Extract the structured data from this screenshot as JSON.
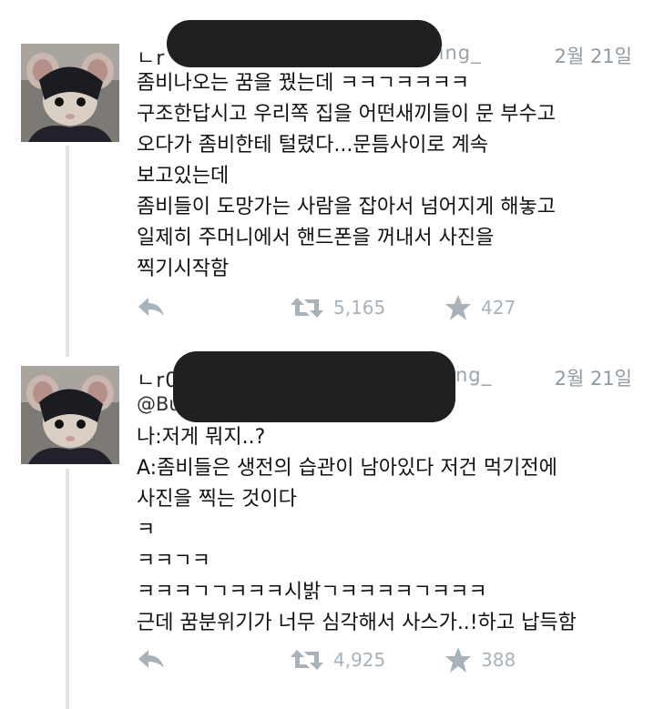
{
  "tweets": [
    {
      "handle_start": "ㄴr",
      "handle_end": "ring_",
      "date": "2월 21일",
      "sub_handle": "",
      "text": "좀비나오는 꿈을 꿨는데 ㅋㅋㄱㅋㅋㅋㅋ\n구조한답시고 우리쪽 집을 어떤새끼들이 문 부수고\n오다가 좀비한테 털렸다...문틈사이로  계속\n보고있는데\n좀비들이 도망가는 사람을 잡아서 넘어지게 해놓고\n일제히 주머니에서 핸드폰을 꺼내서 사진을\n찍기시작함",
      "retweets": "5,165",
      "likes": "427"
    },
    {
      "handle_start": "ㄴr0",
      "handle_end": "ng_",
      "date": "2월 21일",
      "sub_handle": "@Burning_",
      "text": "나:저게 뭐지..?\nA:좀비들은 생전의 습관이 남아있다 저건 먹기전에\n사진을 찍는 것이다\nㅋ\nㅋㅋㄱㅋ\nㅋㅋㅋㄱㄱㅋㅋㅋ시밝ㄱㅋㅋㅋㅋㄱㅋㅋㅋ\n근데 꿈분위기가 너무 심각해서 사스가..!하고 납득함",
      "retweets": "4,925",
      "likes": "388"
    }
  ],
  "icons": {
    "reply": "reply-arrow-icon",
    "retweet": "retweet-icon",
    "like": "star-icon"
  },
  "colors": {
    "action_gray": "#a8b2ba",
    "date_gray": "#8f9aa3",
    "redaction": "#202020"
  }
}
